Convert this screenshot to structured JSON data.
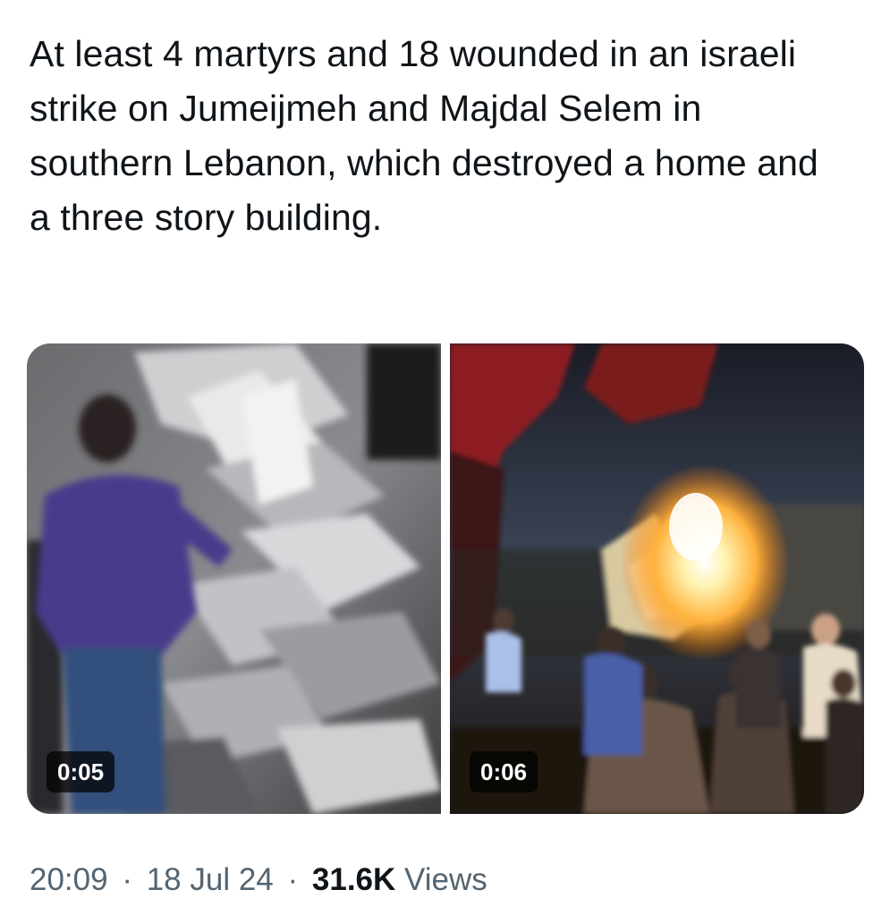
{
  "tweet": {
    "text": "At least 4 martyrs and 18 wounded in an israeli strike on Jumeijmeh and Majdal Selem in southern Lebanon, which destroyed a home and a three story building."
  },
  "media": [
    {
      "duration": "0:05"
    },
    {
      "duration": "0:06"
    }
  ],
  "meta": {
    "time": "20:09",
    "separator": "·",
    "date": "18 Jul 24",
    "views_count": "31.6K",
    "views_label": "Views"
  },
  "colors": {
    "text": "#0f1419",
    "secondary_text": "#536471",
    "badge_bg": "#000000"
  }
}
